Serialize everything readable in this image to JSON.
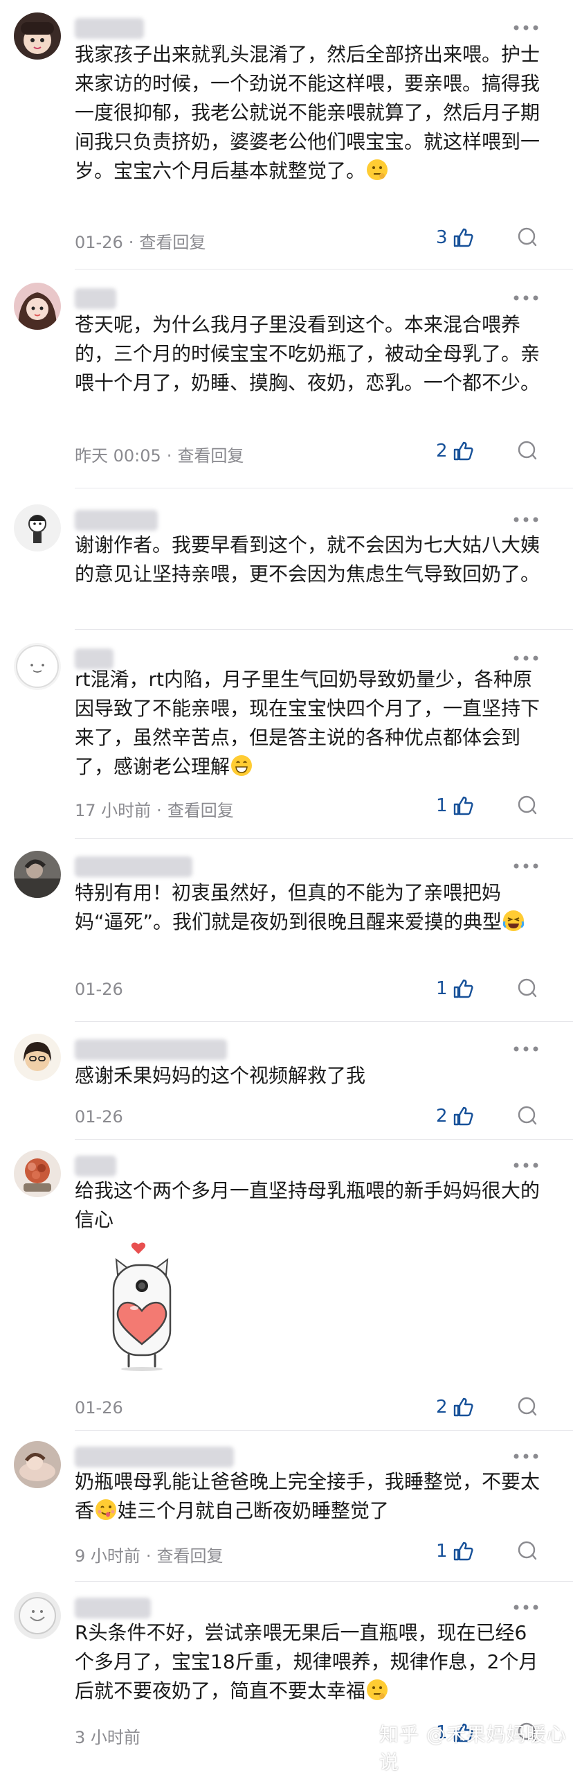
{
  "comments": [
    {
      "text": "我家孩子出来就乳头混淆了，然后全部挤出来喂。护士来家访的时候，一个劲说不能这样喂，要亲喂。搞得我一度很抑郁，我老公就说不能亲喂就算了，然后月子期间我只负责挤奶，婆婆老公他们喂宝宝。就这样喂到一岁。宝宝六个月后基本就整觉了。",
      "time": "01-26",
      "reply": "查看回复",
      "likes": "3"
    },
    {
      "text": "苍天呢，为什么我月子里没看到这个。本来混合喂养的，三个月的时候宝宝不吃奶瓶了，被动全母乳了。亲喂十个月了，奶睡、摸胸、夜奶，恋乳。一个都不少。",
      "time": "昨天 00:05",
      "reply": "查看回复",
      "likes": "2"
    },
    {
      "text": "谢谢作者。我要早看到这个，就不会因为七大姑八大姨的意见让坚持亲喂，更不会因为焦虑生气导致回奶了。"
    },
    {
      "text": "rt混淆，rt内陷，月子里生气回奶导致奶量少，各种原因导致了不能亲喂，现在宝宝快四个月了，一直坚持下来了，虽然辛苦点，但是答主说的各种优点都体会到了，感谢老公理解",
      "time": "17 小时前",
      "reply": "查看回复",
      "likes": "1"
    },
    {
      "text": "特别有用！初衷虽然好，但真的不能为了亲喂把妈妈“逼死”。我们就是夜奶到很晚且醒来爱摸的典型",
      "time": "01-26",
      "likes": "1"
    },
    {
      "text": "感谢禾果妈妈的这个视频解救了我",
      "time": "01-26",
      "likes": "2"
    },
    {
      "text": "给我这个两个多月一直坚持母乳瓶喂的新手妈妈很大的信心",
      "time": "01-26",
      "likes": "2"
    },
    {
      "text_a": "奶瓶喂母乳能让爸爸晚上完全接手，我睡整觉，不要太香",
      "text_b": "娃三个月就自己断夜奶睡整觉了",
      "time": "9 小时前",
      "reply": "查看回复",
      "likes": "1"
    },
    {
      "text": "R头条件不好，尝试亲喂无果后一直瓶喂，现在已经6个多月了，宝宝18斤重，规律喂养，规律作息，2个月后就不要夜奶了，简直不要太幸福",
      "time": "3 小时前",
      "likes": "1"
    }
  ],
  "colors": {
    "like_blue": "#175199",
    "meta_gray": "#8a8a8f",
    "divider": "#e6e6ea"
  },
  "watermark": "知乎 @禾果妈妈暖心说"
}
